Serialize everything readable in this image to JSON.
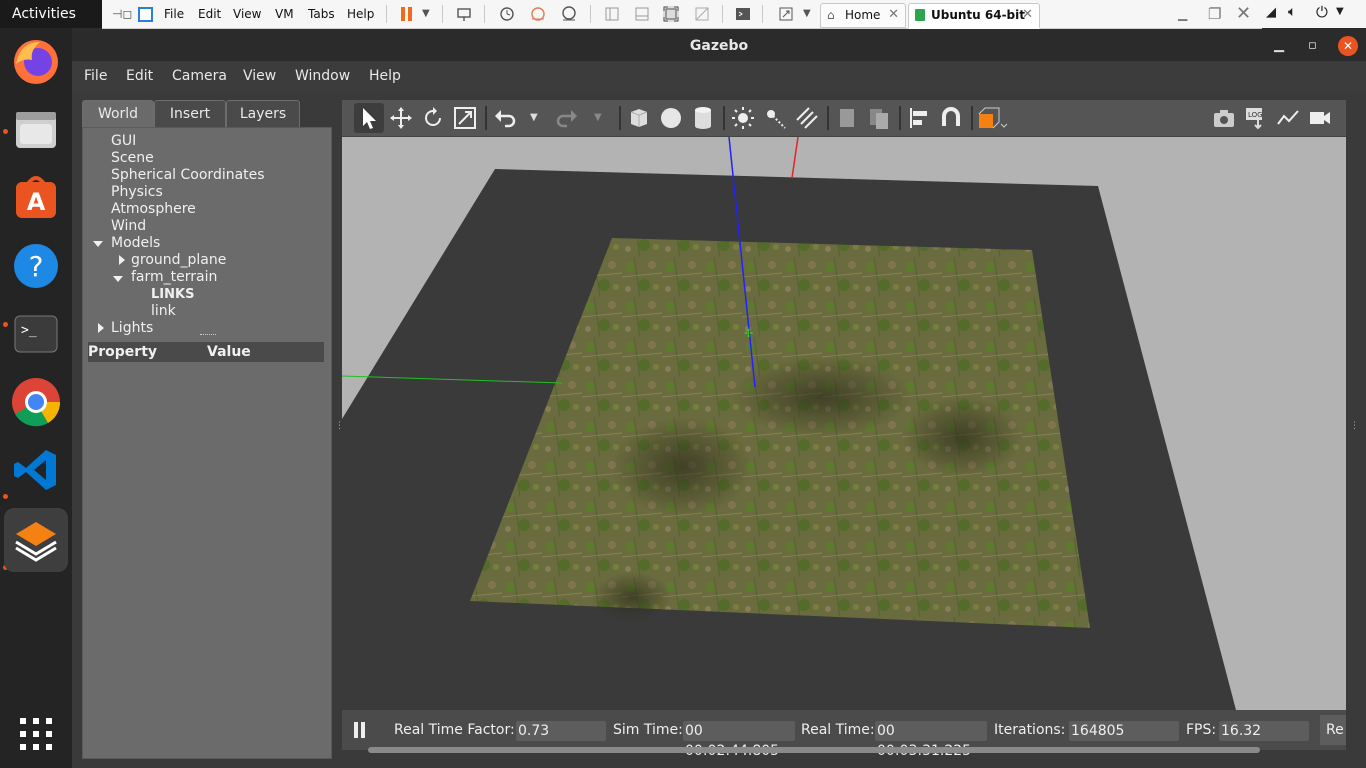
{
  "gnome": {
    "activities": "Activities"
  },
  "vmware": {
    "menus": [
      "File",
      "Edit",
      "View",
      "VM",
      "Tabs",
      "Help"
    ],
    "tabs": [
      {
        "label": "Home",
        "icon": "home-icon"
      },
      {
        "label": "Ubuntu 64-bit",
        "icon": "vm-icon"
      }
    ]
  },
  "dock": {
    "apps": [
      "firefox",
      "files",
      "ubuntu-software",
      "help",
      "terminal",
      "chrome",
      "vscode",
      "gazebo"
    ],
    "show_apps_icon": "grid-icon"
  },
  "gazebo": {
    "title": "Gazebo",
    "menu": [
      "File",
      "Edit",
      "Camera",
      "View",
      "Window",
      "Help"
    ],
    "left_tabs": [
      "World",
      "Insert",
      "Layers"
    ],
    "active_tab": "World",
    "tree": {
      "gui": "GUI",
      "scene": "Scene",
      "spherical": "Spherical Coordinates",
      "physics": "Physics",
      "atmosphere": "Atmosphere",
      "wind": "Wind",
      "models": "Models",
      "ground_plane": "ground_plane",
      "farm_terrain": "farm_terrain",
      "links_header": "LINKS",
      "link": "link",
      "lights": "Lights"
    },
    "property_table": {
      "col1": "Property",
      "col2": "Value"
    },
    "status": {
      "rtf_label": "Real Time Factor:",
      "rtf": "0.73",
      "sim_label": "Sim Time:",
      "sim_time": "00 00:02:44.805",
      "real_label": "Real Time:",
      "real_time": "00 00:03:31.225",
      "iter_label": "Iterations:",
      "iterations": "164805",
      "fps_label": "FPS:",
      "fps": "16.32",
      "reset": "Re"
    }
  },
  "colors": {
    "accent_orange": "#e95420",
    "ground_plane": "#3a3a3a",
    "sky": "#b3b3b3",
    "axis_x": "#e0252c",
    "axis_y": "#22c022",
    "axis_z": "#2222ff"
  }
}
